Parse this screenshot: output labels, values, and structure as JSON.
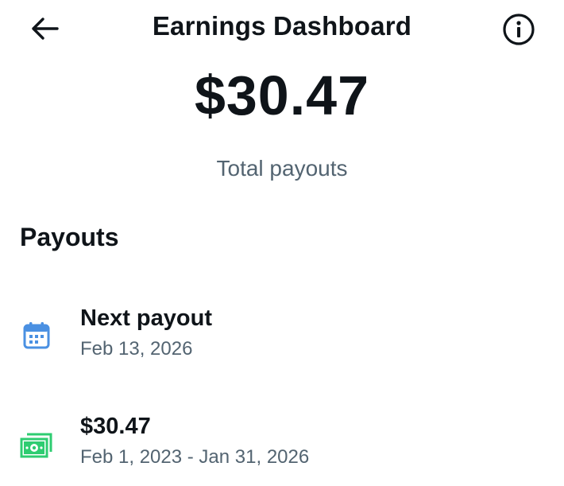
{
  "header": {
    "title": "Earnings Dashboard",
    "back_icon": "arrow-left-icon",
    "info_icon": "info-icon"
  },
  "summary": {
    "amount": "$30.47",
    "caption": "Total payouts"
  },
  "payouts": {
    "section_title": "Payouts",
    "items": [
      {
        "icon": "calendar-icon",
        "icon_color": "#4a90e2",
        "title": "Next payout",
        "subtitle": "Feb 13, 2026"
      },
      {
        "icon": "cash-icon",
        "icon_color": "#2ecc71",
        "title": "$30.47",
        "subtitle": "Feb 1, 2023 - Jan 31, 2026"
      }
    ]
  }
}
